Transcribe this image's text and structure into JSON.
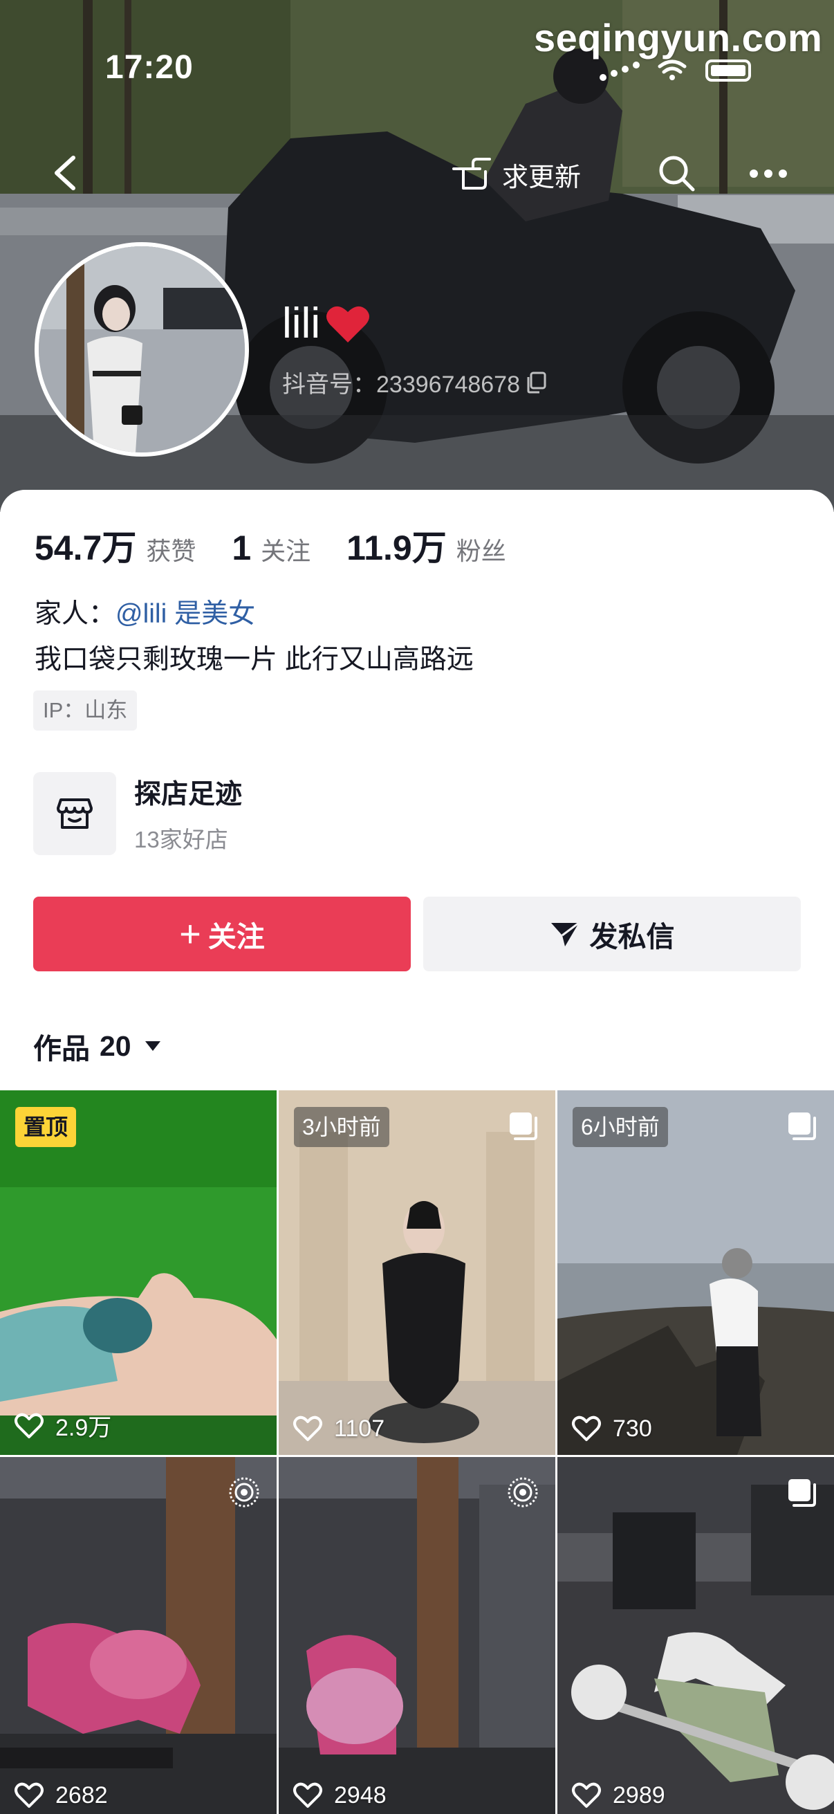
{
  "status_bar": {
    "time": "17:20"
  },
  "watermark": "seqingyun.com",
  "nav": {
    "request_update_label": "求更新"
  },
  "profile": {
    "nickname": "lili",
    "douyin_id": "抖音号：23396748678",
    "stats": [
      {
        "num": "54.7万",
        "label": "获赞"
      },
      {
        "num": "1",
        "label": "关注"
      },
      {
        "num": "11.9万",
        "label": "粉丝"
      }
    ],
    "family_prefix": "家人：",
    "family_mention": "@lili 是美女",
    "bio": "我口袋只剩玫瑰一片  此行又山高路远",
    "ip": "IP：山东"
  },
  "shop": {
    "title": "探店足迹",
    "subtitle": "13家好店"
  },
  "buttons": {
    "follow_label": "关注",
    "message_label": "发私信"
  },
  "works": {
    "label": "作品",
    "count": "20"
  },
  "tiles": [
    {
      "badge": "置顶",
      "likes": "2.9万",
      "type_icon": "none"
    },
    {
      "badge": "3小时前",
      "likes": "1107",
      "type_icon": "photo-set-icon"
    },
    {
      "badge": "6小时前",
      "likes": "730",
      "type_icon": "photo-set-icon"
    },
    {
      "badge": "",
      "likes": "2682",
      "type_icon": "live-photo-icon"
    },
    {
      "badge": "",
      "likes": "2948",
      "type_icon": "live-photo-icon"
    },
    {
      "badge": "",
      "likes": "2989",
      "type_icon": "photo-set-icon"
    }
  ],
  "colors": {
    "follow_red": "#ea3d56",
    "mention_blue": "#2f5fa4",
    "pin_yellow": "#fcd437"
  }
}
